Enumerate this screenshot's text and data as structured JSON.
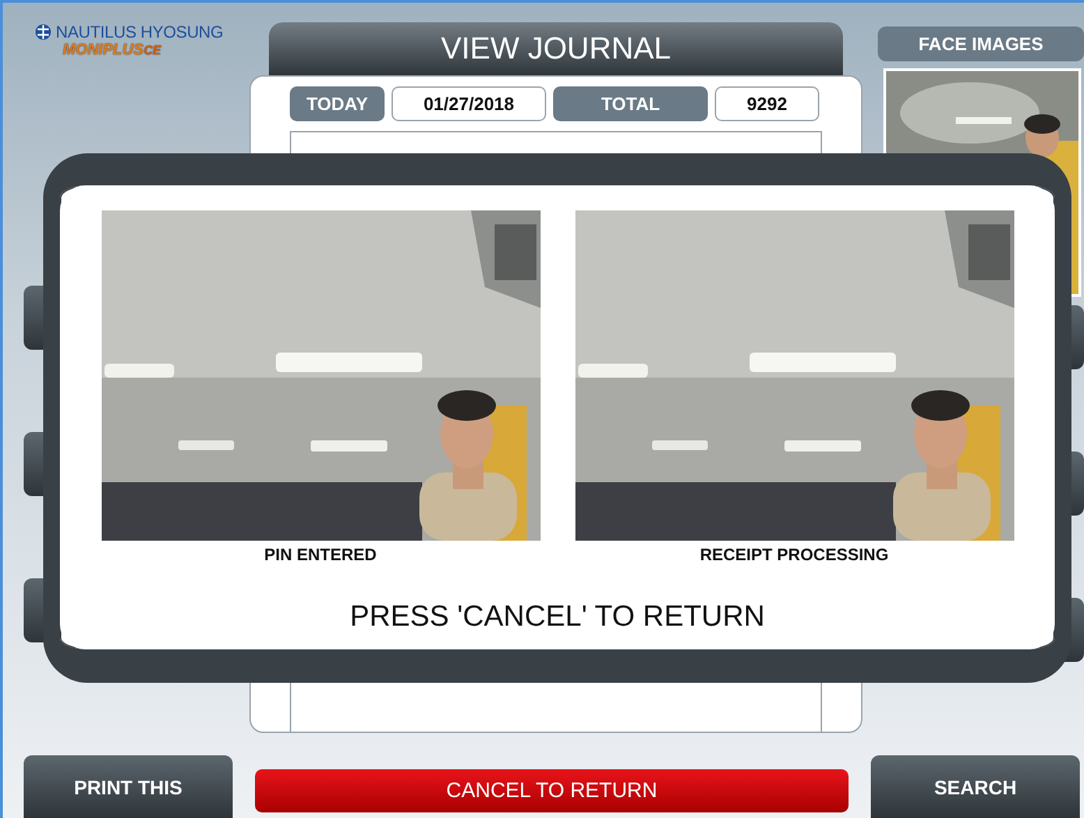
{
  "brand": {
    "company": "NAUTILUS HYOSUNG",
    "product": "MONIPLUS",
    "product_suffix": "CE"
  },
  "title": "VIEW JOURNAL",
  "summary": {
    "today_label": "TODAY",
    "date": "01/27/2018",
    "total_label": "TOTAL",
    "total": "9292"
  },
  "face_images": {
    "label": "FACE IMAGES"
  },
  "modal": {
    "photos": [
      {
        "caption": "PIN ENTERED"
      },
      {
        "caption": "RECEIPT PROCESSING"
      }
    ],
    "message": "PRESS 'CANCEL' TO RETURN"
  },
  "buttons": [
    {
      "label": "PRINT THIS",
      "kind": "dark"
    },
    {
      "label": "CANCEL TO RETURN",
      "kind": "danger"
    },
    {
      "label": "SEARCH",
      "kind": "dark"
    }
  ]
}
